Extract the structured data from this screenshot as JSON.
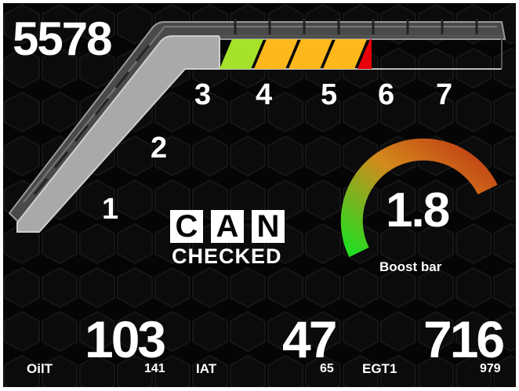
{
  "dashboard": {
    "rpm": "5578",
    "gear_labels": [
      "1",
      "2",
      "3",
      "4",
      "5",
      "6",
      "7"
    ],
    "shift_light_segments_lit": 4,
    "shift_light_colors": [
      "#a6e22a",
      "#ffb81c",
      "#ffb81c",
      "#ffb81c",
      "#e8000b"
    ]
  },
  "boost_gauge": {
    "value": "1.8",
    "label": "Boost bar",
    "arc_colors": [
      "#22dd22",
      "#d48a1c",
      "#c03a14"
    ]
  },
  "logo": {
    "letters": [
      "C",
      "A",
      "N"
    ],
    "tagline": "CHECKED"
  },
  "sensors": {
    "oilt": {
      "label": "OilT",
      "value": "103",
      "sub": "141"
    },
    "iat": {
      "label": "IAT",
      "value": "47",
      "sub": "65"
    },
    "egt1": {
      "label": "EGT1",
      "value": "716",
      "sub": "979"
    }
  }
}
